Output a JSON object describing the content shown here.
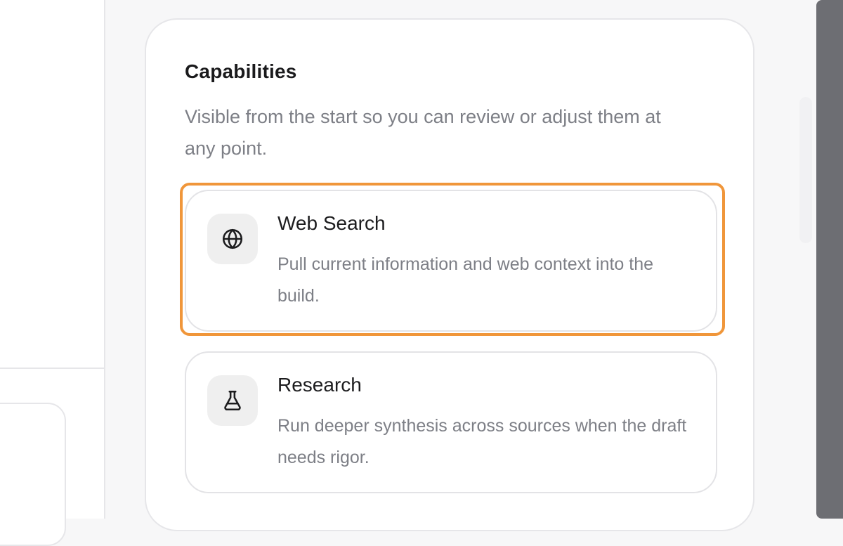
{
  "capabilities": {
    "title": "Capabilities",
    "description": "Visible from the start so you can review or adjust them at any point.",
    "items": [
      {
        "title": "Web Search",
        "description": "Pull current information and web context into the build.",
        "icon": "globe-icon",
        "highlighted": true
      },
      {
        "title": "Research",
        "description": "Run deeper synthesis across sources when the draft needs rigor.",
        "icon": "flask-icon",
        "highlighted": false
      }
    ]
  },
  "colors": {
    "highlight": "#f0963a",
    "muted_text": "#7d7f86",
    "primary_text": "#1a1a1c",
    "icon_bg": "#efefef",
    "rail": "#6d6e73"
  }
}
